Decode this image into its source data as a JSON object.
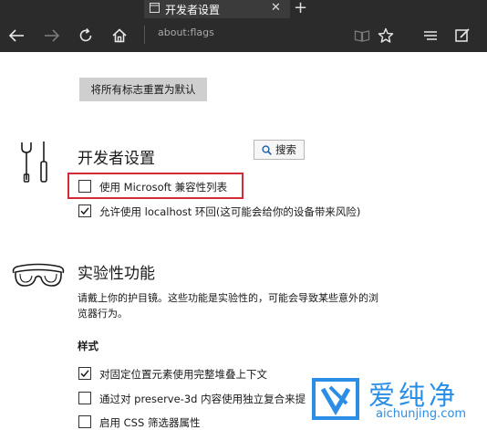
{
  "browser": {
    "tab_title": "开发者设置",
    "tab_close": "✕",
    "new_tab": "+",
    "address": "about:flags"
  },
  "page": {
    "reset_button": "将所有标志重置为默认",
    "developer": {
      "title": "开发者设置",
      "search_label": "搜索",
      "options": [
        {
          "label": "使用 Microsoft 兼容性列表",
          "checked": false
        },
        {
          "label": "允许使用 localhost 环回(这可能会给你的设备带来风险)",
          "checked": true
        }
      ]
    },
    "experimental": {
      "title": "实验性功能",
      "description": "请戴上你的护目镜。这些功能是实验性的，可能会导致某些意外的浏览器行为。",
      "style_heading": "样式",
      "options": [
        {
          "label": "对固定位置元素使用完整堆叠上下文",
          "checked": true
        },
        {
          "label": "通过对 preserve-3d 内容使用独立复合来提",
          "checked": false
        },
        {
          "label": "启用 CSS 筛选器属性",
          "checked": false
        }
      ]
    }
  },
  "watermark": {
    "brand": "爱纯净",
    "url": "aichunjing.com"
  },
  "colors": {
    "chrome_bg": "#2b2b2b",
    "highlight": "#d22c36",
    "watermark": "#2a8ee6"
  }
}
